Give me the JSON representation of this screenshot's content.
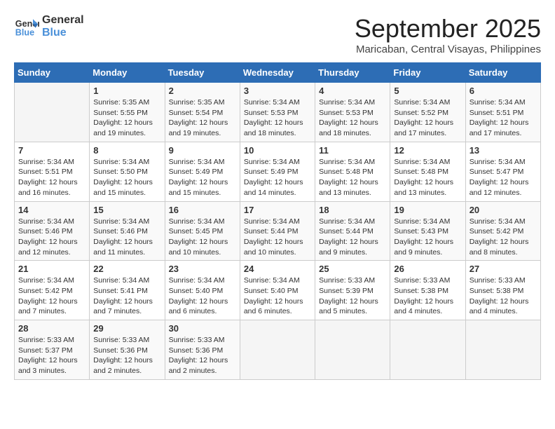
{
  "logo": {
    "line1": "General",
    "line2": "Blue"
  },
  "title": "September 2025",
  "location": "Maricaban, Central Visayas, Philippines",
  "weekdays": [
    "Sunday",
    "Monday",
    "Tuesday",
    "Wednesday",
    "Thursday",
    "Friday",
    "Saturday"
  ],
  "weeks": [
    [
      {
        "day": "",
        "text": ""
      },
      {
        "day": "1",
        "text": "Sunrise: 5:35 AM\nSunset: 5:55 PM\nDaylight: 12 hours\nand 19 minutes."
      },
      {
        "day": "2",
        "text": "Sunrise: 5:35 AM\nSunset: 5:54 PM\nDaylight: 12 hours\nand 19 minutes."
      },
      {
        "day": "3",
        "text": "Sunrise: 5:34 AM\nSunset: 5:53 PM\nDaylight: 12 hours\nand 18 minutes."
      },
      {
        "day": "4",
        "text": "Sunrise: 5:34 AM\nSunset: 5:53 PM\nDaylight: 12 hours\nand 18 minutes."
      },
      {
        "day": "5",
        "text": "Sunrise: 5:34 AM\nSunset: 5:52 PM\nDaylight: 12 hours\nand 17 minutes."
      },
      {
        "day": "6",
        "text": "Sunrise: 5:34 AM\nSunset: 5:51 PM\nDaylight: 12 hours\nand 17 minutes."
      }
    ],
    [
      {
        "day": "7",
        "text": "Sunrise: 5:34 AM\nSunset: 5:51 PM\nDaylight: 12 hours\nand 16 minutes."
      },
      {
        "day": "8",
        "text": "Sunrise: 5:34 AM\nSunset: 5:50 PM\nDaylight: 12 hours\nand 15 minutes."
      },
      {
        "day": "9",
        "text": "Sunrise: 5:34 AM\nSunset: 5:49 PM\nDaylight: 12 hours\nand 15 minutes."
      },
      {
        "day": "10",
        "text": "Sunrise: 5:34 AM\nSunset: 5:49 PM\nDaylight: 12 hours\nand 14 minutes."
      },
      {
        "day": "11",
        "text": "Sunrise: 5:34 AM\nSunset: 5:48 PM\nDaylight: 12 hours\nand 13 minutes."
      },
      {
        "day": "12",
        "text": "Sunrise: 5:34 AM\nSunset: 5:48 PM\nDaylight: 12 hours\nand 13 minutes."
      },
      {
        "day": "13",
        "text": "Sunrise: 5:34 AM\nSunset: 5:47 PM\nDaylight: 12 hours\nand 12 minutes."
      }
    ],
    [
      {
        "day": "14",
        "text": "Sunrise: 5:34 AM\nSunset: 5:46 PM\nDaylight: 12 hours\nand 12 minutes."
      },
      {
        "day": "15",
        "text": "Sunrise: 5:34 AM\nSunset: 5:46 PM\nDaylight: 12 hours\nand 11 minutes."
      },
      {
        "day": "16",
        "text": "Sunrise: 5:34 AM\nSunset: 5:45 PM\nDaylight: 12 hours\nand 10 minutes."
      },
      {
        "day": "17",
        "text": "Sunrise: 5:34 AM\nSunset: 5:44 PM\nDaylight: 12 hours\nand 10 minutes."
      },
      {
        "day": "18",
        "text": "Sunrise: 5:34 AM\nSunset: 5:44 PM\nDaylight: 12 hours\nand 9 minutes."
      },
      {
        "day": "19",
        "text": "Sunrise: 5:34 AM\nSunset: 5:43 PM\nDaylight: 12 hours\nand 9 minutes."
      },
      {
        "day": "20",
        "text": "Sunrise: 5:34 AM\nSunset: 5:42 PM\nDaylight: 12 hours\nand 8 minutes."
      }
    ],
    [
      {
        "day": "21",
        "text": "Sunrise: 5:34 AM\nSunset: 5:42 PM\nDaylight: 12 hours\nand 7 minutes."
      },
      {
        "day": "22",
        "text": "Sunrise: 5:34 AM\nSunset: 5:41 PM\nDaylight: 12 hours\nand 7 minutes."
      },
      {
        "day": "23",
        "text": "Sunrise: 5:34 AM\nSunset: 5:40 PM\nDaylight: 12 hours\nand 6 minutes."
      },
      {
        "day": "24",
        "text": "Sunrise: 5:34 AM\nSunset: 5:40 PM\nDaylight: 12 hours\nand 6 minutes."
      },
      {
        "day": "25",
        "text": "Sunrise: 5:33 AM\nSunset: 5:39 PM\nDaylight: 12 hours\nand 5 minutes."
      },
      {
        "day": "26",
        "text": "Sunrise: 5:33 AM\nSunset: 5:38 PM\nDaylight: 12 hours\nand 4 minutes."
      },
      {
        "day": "27",
        "text": "Sunrise: 5:33 AM\nSunset: 5:38 PM\nDaylight: 12 hours\nand 4 minutes."
      }
    ],
    [
      {
        "day": "28",
        "text": "Sunrise: 5:33 AM\nSunset: 5:37 PM\nDaylight: 12 hours\nand 3 minutes."
      },
      {
        "day": "29",
        "text": "Sunrise: 5:33 AM\nSunset: 5:36 PM\nDaylight: 12 hours\nand 2 minutes."
      },
      {
        "day": "30",
        "text": "Sunrise: 5:33 AM\nSunset: 5:36 PM\nDaylight: 12 hours\nand 2 minutes."
      },
      {
        "day": "",
        "text": ""
      },
      {
        "day": "",
        "text": ""
      },
      {
        "day": "",
        "text": ""
      },
      {
        "day": "",
        "text": ""
      }
    ]
  ]
}
